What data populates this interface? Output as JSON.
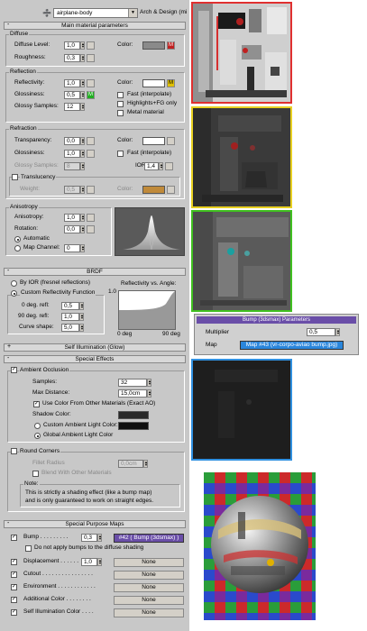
{
  "toolbar": {
    "material_name": "airplane-body",
    "material_type": "Arch & Design (mi"
  },
  "rollouts": {
    "main": "Main material parameters",
    "brdf": "BRDF",
    "self_illum": "Self Illumination (Glow)",
    "special_effects": "Special Effects",
    "special_maps": "Special Purpose Maps"
  },
  "diffuse": {
    "title": "Diffuse",
    "level_label": "Diffuse Level:",
    "level": "1,0",
    "roughness_label": "Roughness:",
    "roughness": "0,3",
    "color_label": "Color:",
    "map_badge": "M"
  },
  "reflection": {
    "title": "Reflection",
    "reflectivity_label": "Reflectivity:",
    "reflectivity": "1,0",
    "glossiness_label": "Glossiness:",
    "glossiness": "0,5",
    "samples_label": "Glossy Samples:",
    "samples": "12",
    "color_label": "Color:",
    "map_badge": "M",
    "gloss_badge": "M",
    "fast_label": "Fast (interpolate)",
    "highlights_label": "Highlights+FG only",
    "metal_label": "Metal material"
  },
  "refraction": {
    "title": "Refraction",
    "transparency_label": "Transparency:",
    "transparency": "0,0",
    "glossiness_label": "Glossiness:",
    "glossiness": "1,0",
    "samples_label": "Glossy Samples:",
    "samples": "8",
    "color_label": "Color:",
    "fast_label": "Fast (interpolate)",
    "ior_label": "IOR:",
    "ior": "1,4",
    "translucency_label": "Translucency",
    "weight_label": "Weight:",
    "weight": "0,5",
    "trans_color_label": "Color:"
  },
  "anisotropy": {
    "title": "Anisotropy",
    "anisotropy_label": "Anisotropy:",
    "anisotropy": "1,0",
    "rotation_label": "Rotation:",
    "rotation": "0,0",
    "automatic_label": "Automatic",
    "map_channel_label": "Map Channel:",
    "map_channel": "0"
  },
  "brdf": {
    "by_ior_label": "By IOR (fresnel reflections)",
    "custom_label": "Custom Reflectivity Function",
    "deg0_label": "0 deg. refl:",
    "deg0": "0,5",
    "deg90_label": "90 deg. refl:",
    "deg90": "1,0",
    "curve_label": "Curve shape:",
    "curve": "5,0",
    "graph_title": "Reflectivity vs. Angle:",
    "y_top": "1.0",
    "x_left": "0 deg",
    "x_right": "90 deg"
  },
  "ao": {
    "title": "Ambient Occlusion",
    "samples_label": "Samples:",
    "samples": "32",
    "max_distance_label": "Max Distance:",
    "max_distance": "15,0cm",
    "use_color_label": "Use Color From Other Materials (Exact AO)",
    "shadow_color_label": "Shadow Color:",
    "custom_ambient_label": "Custom Ambient Light Color:",
    "global_ambient_label": "Global Ambient Light Color"
  },
  "round_corners": {
    "title": "Round Corners",
    "fillet_label": "Fillet Radius",
    "fillet": "0,0cm",
    "blend_label": "Blend With Other Materials",
    "note_title": "Note:",
    "note_line1": "This is strictly a shading effect (like a bump map)",
    "note_line2": "and is only guaranteed to work on straight edges."
  },
  "maps": {
    "bump_label": "Bump . . . . . . . . .",
    "bump_value": "0,3",
    "bump_map": "#42 ( Bump (3dsmax) )",
    "no_bump_diffuse_label": "Do not apply bumps to the diffuse shading",
    "displacement_label": "Displacement . . . . . .",
    "displacement_value": "1,0",
    "displacement_map": "None",
    "cutout_label": "Cutout . . . . . . . . . . . . . . . .",
    "cutout_map": "None",
    "environment_label": "Environment . . . . . . . . . . . .",
    "environment_map": "None",
    "additional_color_label": "Additional Color . . . . . . . .",
    "additional_color_map": "None",
    "self_illum_label": "Self Illumination Color . . . .",
    "self_illum_map": "None"
  },
  "bump_params": {
    "header": "Bump (3dsmax) Parameters",
    "multiplier_label": "Multiplier",
    "multiplier": "0,5",
    "map_label": "Map",
    "map_value": "Map #43 (vr-corpo-aviao bump.jpg)"
  },
  "colors": {
    "diffuse_color": "#8a8a8a",
    "reflection_color": "#ffffff",
    "refraction_color": "#ffffff",
    "translucency_color": "#c08a3a",
    "shadow_color": "#2a2a2a",
    "custom_ambient_color": "#101010",
    "thumb_border_red": "#e03030",
    "thumb_border_yellow": "#e8d020",
    "thumb_border_green": "#40c020",
    "thumb_border_blue": "#3090e0",
    "bump_map_button": "#2a86dc",
    "bump_header": "#6a4ea8"
  }
}
